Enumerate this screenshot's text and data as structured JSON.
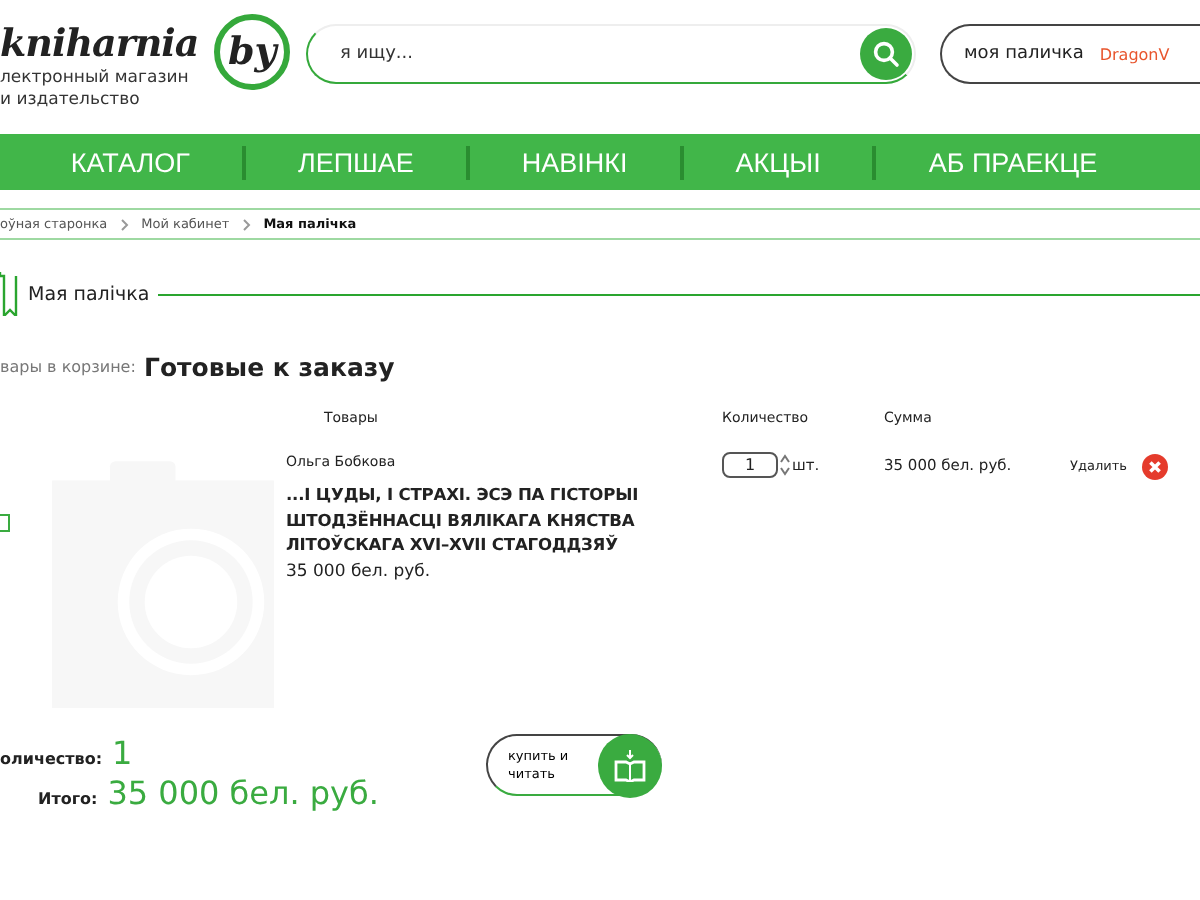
{
  "logo": {
    "name": "kniharnia",
    "domain": "by",
    "tagline": [
      "лектронный магазин",
      "и издательство"
    ]
  },
  "search": {
    "placeholder": "я ищу..."
  },
  "account": {
    "label": "моя паличка",
    "user": "DragonV"
  },
  "nav": [
    "КАТАЛОГ",
    "ЛЕПШАЕ",
    "НАВІНКІ",
    "АКЦЫІ",
    "АБ ПРАЕКЦЕ"
  ],
  "breadcrumbs": [
    {
      "label": "оўная старонка",
      "current": false
    },
    {
      "label": "Мой кабинет",
      "current": false
    },
    {
      "label": "Мая палічка",
      "current": true
    }
  ],
  "section_title": "Мая палічка",
  "cart": {
    "label": "вары в корзине:",
    "title": "Готовые к заказу"
  },
  "columns": [
    "Товары",
    "Количество",
    "Сумма"
  ],
  "items": [
    {
      "checked": false,
      "author": "Ольга Бобкова",
      "title": "...І ЦУДЫ, І СТРАХІ. ЭСЭ ПА ГІСТОРЫІ ШТОДЗЁННАСЦІ ВЯЛІКАГА КНЯСТВА ЛІТОЎСКАГА XVI–XVII СТАГОДДЗЯЎ",
      "price": "35 000 бел. руб.",
      "quantity": "1",
      "unit": "шт.",
      "sum": "35 000 бел. руб.",
      "remove": "Удалить"
    }
  ],
  "summary": {
    "quantity_label": "оличество:",
    "quantity": "1",
    "total_label": "Итого:",
    "total": "35 000 бел. руб."
  },
  "buy_button": "купить и читать"
}
